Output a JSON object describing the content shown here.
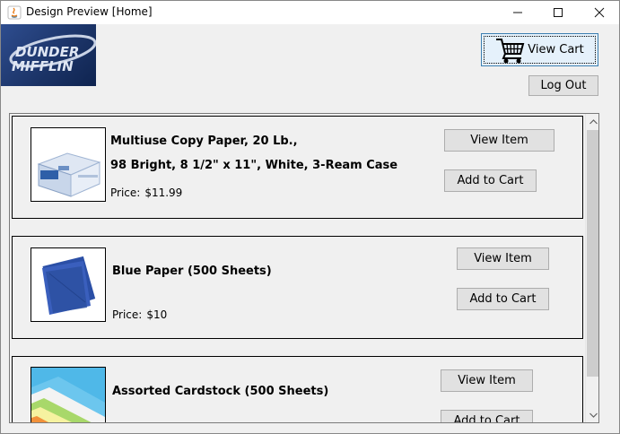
{
  "window": {
    "title": "Design Preview [Home]",
    "controls": {
      "minimize": "—",
      "maximize": "☐",
      "close": "✕"
    }
  },
  "header": {
    "logo_text_line1": "DUNDER",
    "logo_text_line2": "MIFFLIN",
    "view_cart_label": "View Cart",
    "logout_label": "Log Out"
  },
  "products": [
    {
      "name_line1": "Multiuse Copy Paper, 20 Lb.,",
      "name_line2": "98 Bright, 8 1/2\" x 11\", White, 3-Ream Case",
      "price_label": "Price:",
      "price": "$11.99",
      "view_label": "View Item",
      "add_label": "Add to Cart"
    },
    {
      "name_line1": "Blue Paper (500 Sheets)",
      "price_label": "Price:",
      "price": "$10",
      "view_label": "View Item",
      "add_label": "Add to Cart"
    },
    {
      "name_line1": "Assorted Cardstock (500 Sheets)",
      "view_label": "View Item",
      "add_label": "Add to Cart"
    }
  ],
  "colors": {
    "accent_border": "#3c7fb1",
    "logo_bg": "#1b3366"
  }
}
